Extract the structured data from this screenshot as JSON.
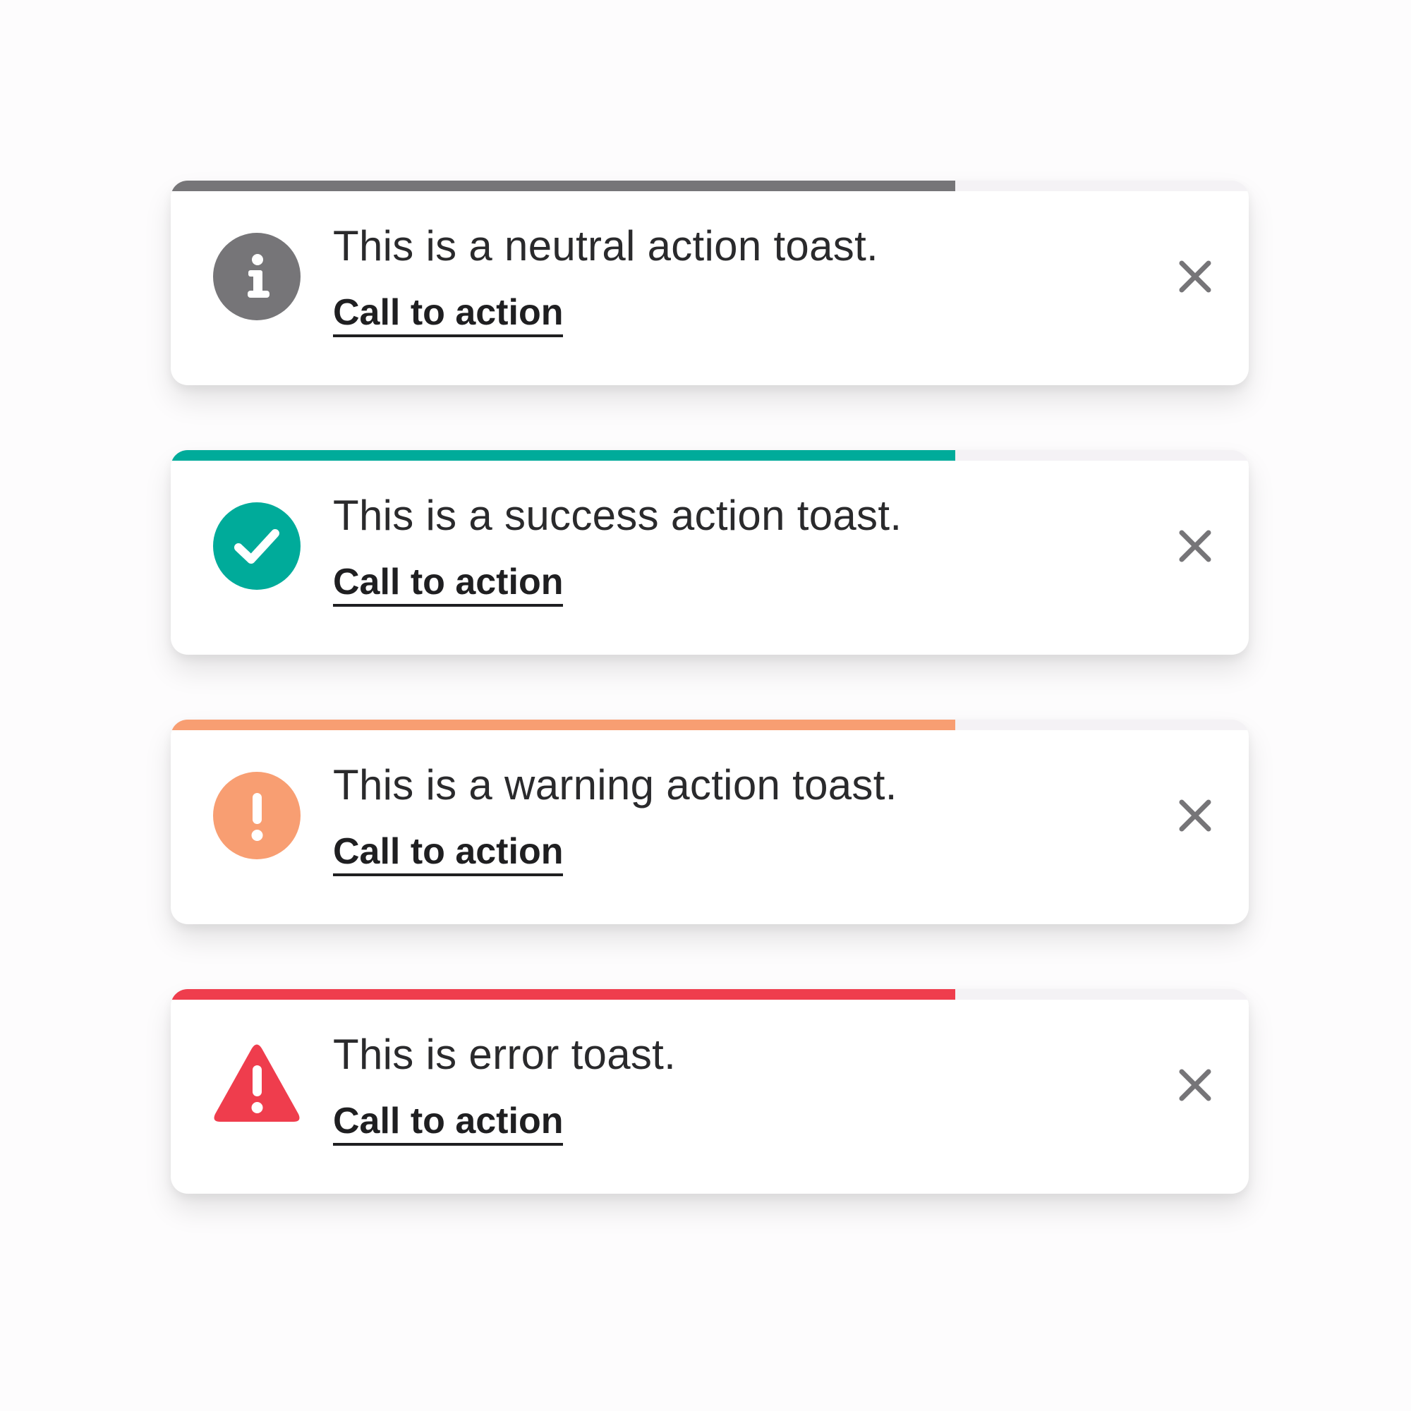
{
  "toasts": [
    {
      "variant": "neutral",
      "icon": "info-icon",
      "color": "#767578",
      "progress_percent": 72.8,
      "message": "This is a neutral action toast.",
      "cta_label": "Call to action"
    },
    {
      "variant": "success",
      "icon": "check-circle-icon",
      "color": "#00ab9a",
      "progress_percent": 72.8,
      "message": "This is a success action toast.",
      "cta_label": "Call to action"
    },
    {
      "variant": "warning",
      "icon": "exclamation-circle-icon",
      "color": "#f89e72",
      "progress_percent": 72.8,
      "message": "This is a warning action toast.",
      "cta_label": "Call to action"
    },
    {
      "variant": "error",
      "icon": "warning-triangle-icon",
      "color": "#ef3d4d",
      "progress_percent": 72.8,
      "message": "This is error toast.",
      "cta_label": "Call to action"
    }
  ],
  "close_icon": "close-icon",
  "close_color": "#767578"
}
